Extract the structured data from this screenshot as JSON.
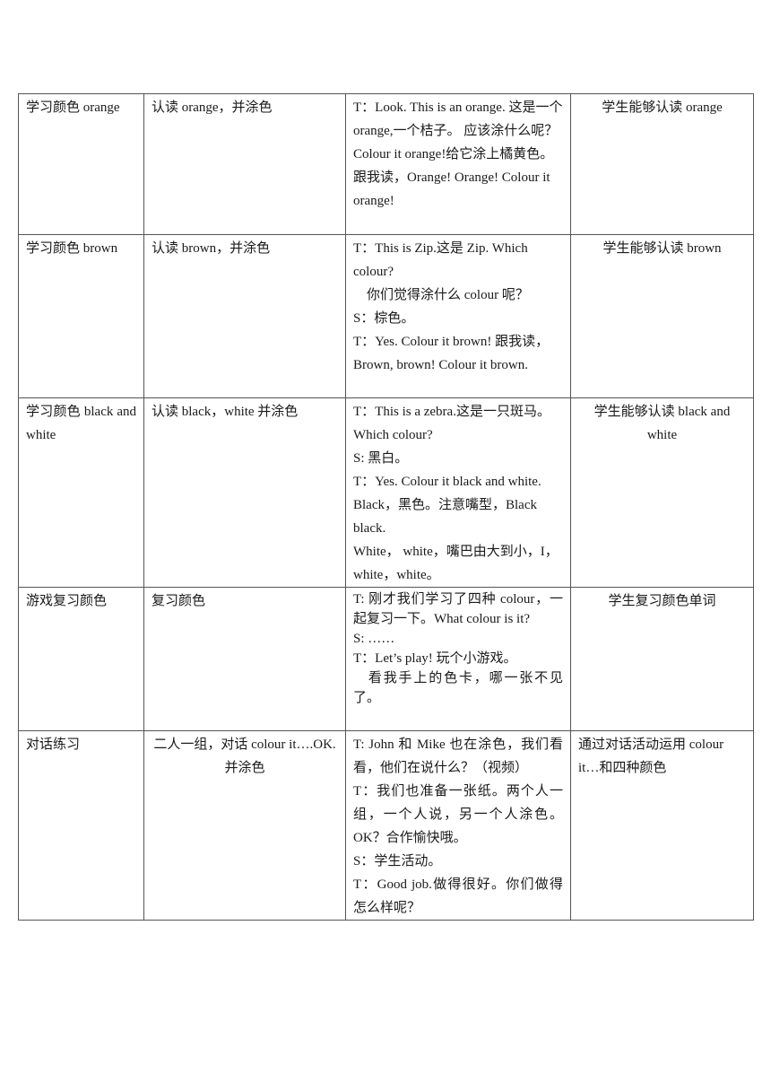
{
  "table": {
    "rows": [
      {
        "step": "学习颜色 orange",
        "activity": "认读 orange，并涂色",
        "dialogue": [
          "T：Look. This is an orange.  这是一个 orange,一个桔子。 应该涂什么呢？Colour it orange!给它涂上橘黄色。",
          "跟我读，Orange! Orange! Colour it orange!"
        ],
        "goal": "学生能够认读 orange"
      },
      {
        "step": "学习颜色 brown",
        "activity": "认读 brown，并涂色",
        "dialogue": [
          "T：This is Zip.这是 Zip. Which colour?",
          "　你们觉得涂什么 colour 呢？",
          "S：棕色。",
          "T：Yes. Colour it brown!  跟我读，Brown, brown! Colour it brown."
        ],
        "goal": "学生能够认读 brown"
      },
      {
        "step": "学习颜色  black and white",
        "activity": "认读 black，white  并涂色",
        "dialogue": [
          "T：This is a zebra.这是一只斑马。Which colour?",
          "S:  黑白。",
          "T：Yes. Colour it black and white.",
          "  Black，黑色。注意嘴型，Black black.",
          "  White，  white，嘴巴由大到小，I，white，white。"
        ],
        "goal": "学生能够认读 black and white"
      },
      {
        "step": "游戏复习颜色",
        "activity": "复习颜色",
        "dialogue": [
          "T:  刚才我们学习了四种 colour，一起复习一下。What  colour  is it?",
          "S:  ……",
          "T：Let’s play!  玩个小游戏。",
          "　看我手上的色卡，哪一张不见了。"
        ],
        "goal": "学生复习颜色单词"
      },
      {
        "step": "对话练习",
        "activity": "二人一组，对话 colour it….OK.  并涂色",
        "dialogue": [
          "T:  John  和  Mike  也在涂色，我们看看，他们在说什么？（视频）",
          "T：我们也准备一张纸。两个人一组，一个人说，另一个人涂色。OK？合作愉快哦。",
          "S：学生活动。",
          "T：Good job.做得很好。你们做得怎么样呢？"
        ],
        "goal": "通过对话活动运用 colour it…和四种颜色"
      }
    ]
  }
}
